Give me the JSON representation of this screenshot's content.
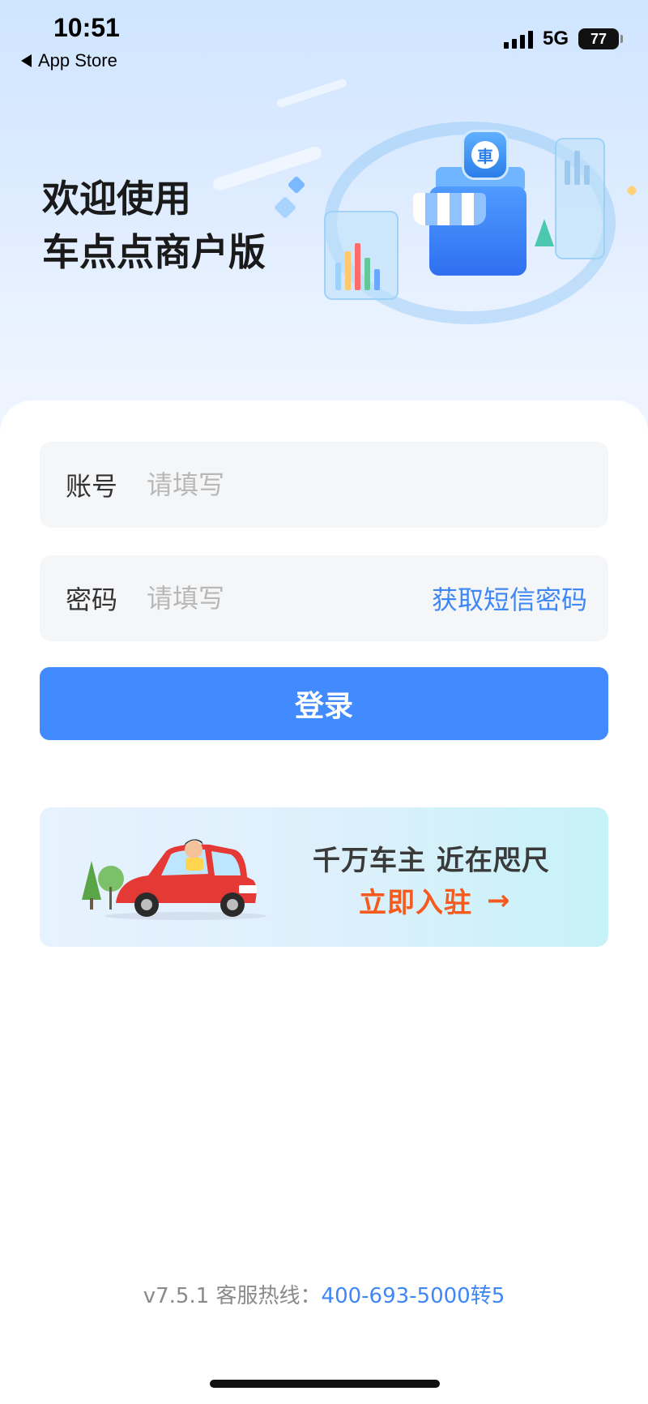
{
  "status_bar": {
    "time": "10:51",
    "back_label": "App Store",
    "network": "5G",
    "battery": "77"
  },
  "hero": {
    "welcome_line1": "欢迎使用",
    "welcome_line2": "车点点商户版",
    "badge_char": "車"
  },
  "form": {
    "account_label": "账号",
    "account_placeholder": "请填写",
    "password_label": "密码",
    "password_placeholder": "请填写",
    "sms_link": "获取短信密码",
    "login_button": "登录"
  },
  "banner": {
    "title": "千万车主 近在咫尺",
    "cta": "立即入驻",
    "cta_arrow": "→"
  },
  "footer": {
    "version_text": "v7.5.1 客服热线：",
    "phone": "400-693-5000转5"
  },
  "colors": {
    "accent": "#418bff",
    "link": "#3f87f5",
    "cta": "#f55a1f"
  },
  "icons": {
    "back": "back-arrow-icon",
    "signal": "signal-icon",
    "battery": "battery-icon",
    "arrow": "arrow-right-icon"
  }
}
